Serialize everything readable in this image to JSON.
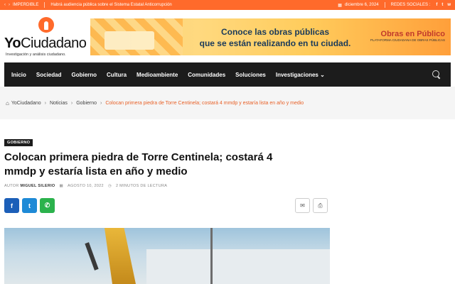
{
  "topbar": {
    "label": "IMPERDIBLE",
    "headline": "Habrá audiencia pública sobre el Sistema Estatal Anticorrupción",
    "date": "diciembre 6, 2024",
    "social_label": "REDES SOCIALES :",
    "social_icons": [
      "f",
      "t",
      "w"
    ]
  },
  "logo": {
    "name_bold": "Yo",
    "name_thin": "Ciudadano",
    "tagline": "Investigación y análisis ciudadano."
  },
  "banner": {
    "line1": "Conoce las obras públicas",
    "line2": "que se están realizando en tu ciudad.",
    "brand": "Obras en Público",
    "brand_sub": "PLATAFORMA CIUDADANA DE OBRAS PÚBLICAS"
  },
  "nav": {
    "items": [
      "Inicio",
      "Sociedad",
      "Gobierno",
      "Cultura",
      "Medioambiente",
      "Comunidades",
      "Soluciones",
      "Investigaciones ⌄"
    ]
  },
  "breadcrumb": {
    "items": [
      "YoCiudadano",
      "Noticias",
      "Gobierno"
    ],
    "current": "Colocan primera piedra de Torre Centinela; costará 4 mmdp y estaría lista en año y medio"
  },
  "article": {
    "category": "GOBIERNO",
    "title": "Colocan primera piedra de Torre Centinela; costará 4 mmdp y estaría lista en año y medio",
    "author_label": "AUTOR",
    "author": "MIGUEL SILERIO",
    "date": "AGOSTO 10, 2022",
    "read_time": "2 MINUTOS DE LECTURA"
  },
  "colors": {
    "accent": "#ff6a2b",
    "nav_bg": "#1c1c1c",
    "facebook": "#1c5fb8",
    "twitter": "#1e8ad6",
    "whatsapp": "#2bb24c"
  }
}
